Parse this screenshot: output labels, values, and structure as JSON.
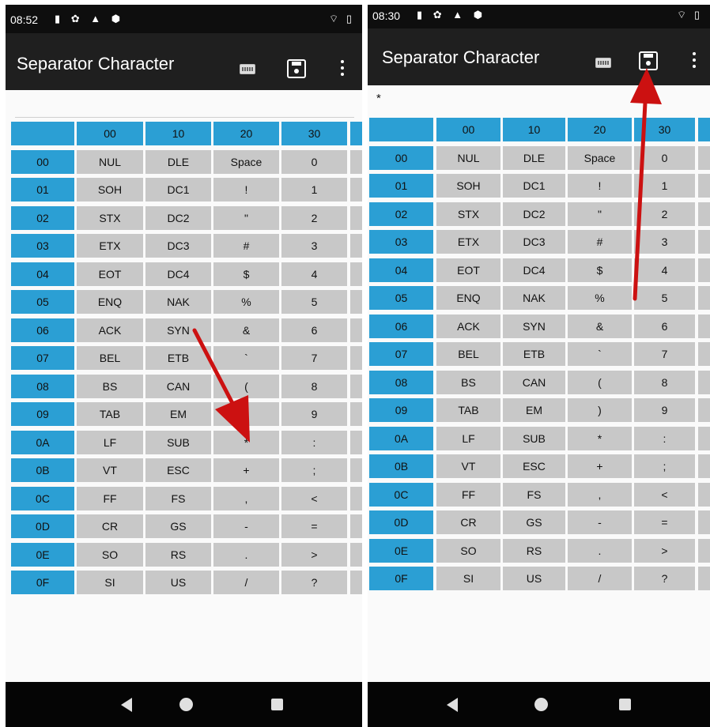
{
  "left": {
    "status_time": "08:52",
    "title": "Separator Character",
    "selected_value": ""
  },
  "right": {
    "status_time": "08:30",
    "title": "Separator Character",
    "selected_value": "*"
  },
  "status_icons": "▮ ✿ ▲ ⬢",
  "status_right": "⌔ ▯",
  "table": {
    "corner": "",
    "col_headers": [
      "00",
      "10",
      "20",
      "30"
    ],
    "rows": [
      {
        "h": "00",
        "c": [
          "NUL",
          "DLE",
          "Space",
          "0"
        ]
      },
      {
        "h": "01",
        "c": [
          "SOH",
          "DC1",
          "!",
          "1"
        ]
      },
      {
        "h": "02",
        "c": [
          "STX",
          "DC2",
          "\"",
          "2"
        ]
      },
      {
        "h": "03",
        "c": [
          "ETX",
          "DC3",
          "#",
          "3"
        ]
      },
      {
        "h": "04",
        "c": [
          "EOT",
          "DC4",
          "$",
          "4"
        ]
      },
      {
        "h": "05",
        "c": [
          "ENQ",
          "NAK",
          "%",
          "5"
        ]
      },
      {
        "h": "06",
        "c": [
          "ACK",
          "SYN",
          "&",
          "6"
        ]
      },
      {
        "h": "07",
        "c": [
          "BEL",
          "ETB",
          "`",
          "7"
        ]
      },
      {
        "h": "08",
        "c": [
          "BS",
          "CAN",
          "(",
          "8"
        ]
      },
      {
        "h": "09",
        "c": [
          "TAB",
          "EM",
          ")",
          "9"
        ]
      },
      {
        "h": "0A",
        "c": [
          "LF",
          "SUB",
          "*",
          ":"
        ]
      },
      {
        "h": "0B",
        "c": [
          "VT",
          "ESC",
          "+",
          ";"
        ]
      },
      {
        "h": "0C",
        "c": [
          "FF",
          "FS",
          ",",
          "<"
        ]
      },
      {
        "h": "0D",
        "c": [
          "CR",
          "GS",
          "-",
          "="
        ]
      },
      {
        "h": "0E",
        "c": [
          "SO",
          "RS",
          ".",
          ">"
        ]
      },
      {
        "h": "0F",
        "c": [
          "SI",
          "US",
          "/",
          "?"
        ]
      }
    ]
  },
  "colors": {
    "header_cell": "#2b9fd4",
    "value_cell": "#c8c8c8",
    "annotation_arrow": "#cc1111"
  },
  "icons": {
    "keyboard": "keyboard-icon",
    "save": "save-icon",
    "more": "more-vert-icon",
    "nav_back": "back-triangle-icon",
    "nav_home": "home-circle-icon",
    "nav_recents": "recents-square-icon"
  }
}
